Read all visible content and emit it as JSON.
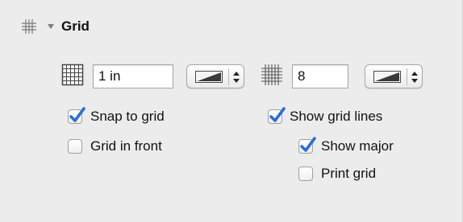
{
  "section": {
    "title": "Grid"
  },
  "fields": {
    "spacing_value": "1 in",
    "subdivision_value": "8"
  },
  "checkboxes": {
    "snap_to_grid": {
      "label": "Snap to grid",
      "checked": true
    },
    "grid_in_front": {
      "label": "Grid in front",
      "checked": false
    },
    "show_grid_lines": {
      "label": "Show grid lines",
      "checked": true
    },
    "show_major": {
      "label": "Show major",
      "checked": true
    },
    "print_grid": {
      "label": "Print grid",
      "checked": false
    }
  },
  "icons": {
    "section": "grid-icon",
    "spacing": "grid-spacing-icon",
    "subdivision": "grid-subdivision-icon",
    "popup_swatch": "line-color-swatch",
    "stepper": "up-down-stepper-icon",
    "disclosure": "triangle-down-icon"
  },
  "colors": {
    "panel_bg": "#ececec",
    "check_blue": "#2a6fd6",
    "swatch_dark": "#3a3a3a"
  }
}
